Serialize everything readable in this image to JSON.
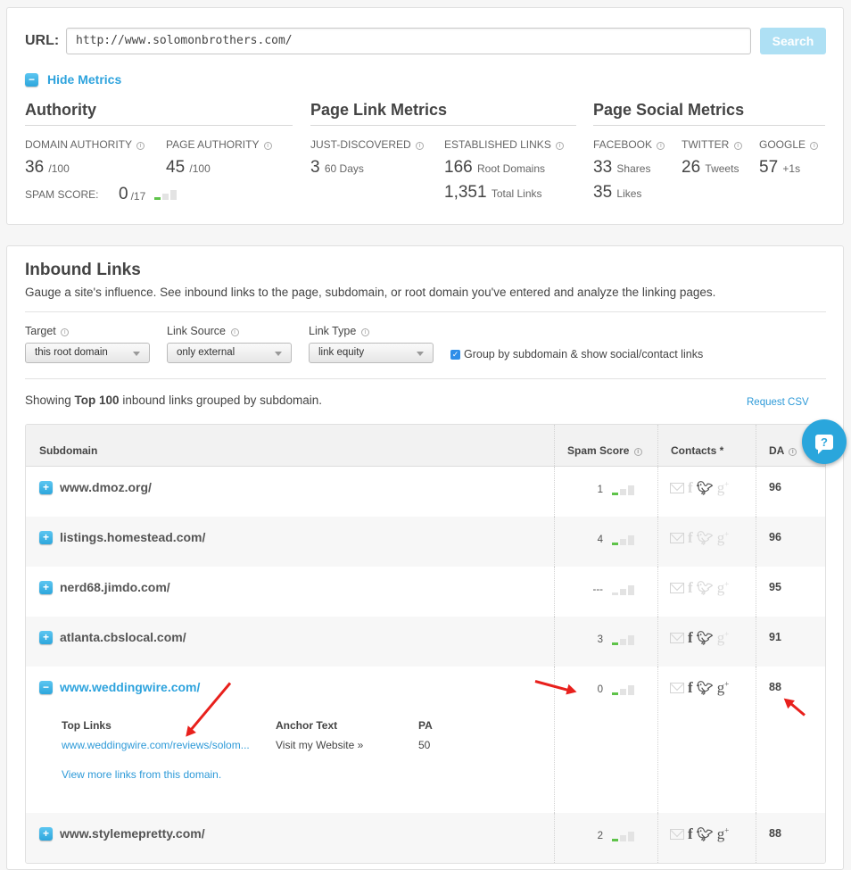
{
  "url_bar": {
    "label": "URL:",
    "value": "http://www.solomonbrothers.com/",
    "search_label": "Search"
  },
  "metrics_toggle": {
    "label": "Hide Metrics",
    "icon": "minus"
  },
  "authority": {
    "title": "Authority",
    "domain_authority": {
      "label": "DOMAIN AUTHORITY",
      "value": "36",
      "unit": "/100"
    },
    "page_authority": {
      "label": "PAGE AUTHORITY",
      "value": "45",
      "unit": "/100"
    },
    "spam_score": {
      "label": "SPAM SCORE:",
      "value": "0",
      "unit": "/17",
      "level": 1,
      "levels": 3
    }
  },
  "page_link_metrics": {
    "title": "Page Link Metrics",
    "just_discovered": {
      "label": "JUST-DISCOVERED",
      "value": "3",
      "unit": "60 Days"
    },
    "established_links": {
      "label": "ESTABLISHED LINKS",
      "root_domains": "166",
      "root_domains_unit": "Root Domains",
      "total_links": "1,351",
      "total_links_unit": "Total Links"
    }
  },
  "page_social_metrics": {
    "title": "Page Social Metrics",
    "facebook": {
      "label": "FACEBOOK",
      "shares": "33",
      "shares_unit": "Shares",
      "likes": "35",
      "likes_unit": "Likes"
    },
    "twitter": {
      "label": "TWITTER",
      "value": "26",
      "unit": "Tweets"
    },
    "google": {
      "label": "GOOGLE",
      "value": "57",
      "unit": "+1s"
    }
  },
  "inbound": {
    "title": "Inbound Links",
    "description": "Gauge a site's influence. See inbound links to the page, subdomain, or root domain you've entered and analyze the linking pages.",
    "filters": [
      {
        "label": "Target",
        "value": "this root domain"
      },
      {
        "label": "Link Source",
        "value": "only external"
      },
      {
        "label": "Link Type",
        "value": "link equity"
      }
    ],
    "group_checkbox": {
      "label": "Group by subdomain & show social/contact links",
      "checked": true
    },
    "showing_prefix": "Showing ",
    "showing_bold": "Top 100",
    "showing_suffix": " inbound links grouped by subdomain.",
    "csv_label": "Request CSV",
    "columns": {
      "subdomain": "Subdomain",
      "spam": "Spam Score",
      "contacts": "Contacts *",
      "da": "DA"
    },
    "rows": [
      {
        "domain": "www.dmoz.org/",
        "spam": "1",
        "spam_level": 1,
        "contacts": {
          "email": false,
          "facebook": false,
          "twitter": true,
          "google": false
        },
        "da": "96"
      },
      {
        "domain": "listings.homestead.com/",
        "spam": "4",
        "spam_level": 1,
        "contacts": {
          "email": false,
          "facebook": false,
          "twitter": false,
          "google": false
        },
        "da": "96"
      },
      {
        "domain": "nerd68.jimdo.com/",
        "spam": "---",
        "spam_level": 0,
        "contacts": {
          "email": false,
          "facebook": false,
          "twitter": false,
          "google": false
        },
        "da": "95"
      },
      {
        "domain": "atlanta.cbslocal.com/",
        "spam": "3",
        "spam_level": 1,
        "contacts": {
          "email": false,
          "facebook": true,
          "twitter": true,
          "google": false
        },
        "da": "91"
      },
      {
        "domain": "www.weddingwire.com/",
        "spam": "0",
        "spam_level": 1,
        "contacts": {
          "email": false,
          "facebook": true,
          "twitter": true,
          "google": true
        },
        "da": "88",
        "expanded": true,
        "details": {
          "top_links_label": "Top Links",
          "anchor_label": "Anchor Text",
          "pa_label": "PA",
          "link": "www.weddingwire.com/reviews/solom...",
          "anchor": "Visit my Website »",
          "pa": "50",
          "more_label": "View more links from this domain."
        }
      },
      {
        "domain": "www.stylemepretty.com/",
        "spam": "2",
        "spam_level": 1,
        "contacts": {
          "email": false,
          "facebook": true,
          "twitter": true,
          "google": true
        },
        "da": "88"
      }
    ]
  },
  "help_button": {
    "label": "?"
  }
}
